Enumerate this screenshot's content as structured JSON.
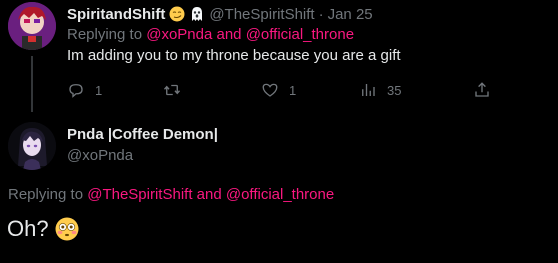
{
  "reply_tweet": {
    "author_name": "SpiritandShift",
    "author_handle": "@TheSpiritShift",
    "separator": "·",
    "date": "Jan 25",
    "badge_icons": [
      "smirk-emoji-icon",
      "ghost-emoji-icon"
    ],
    "replying_prefix": "Replying to",
    "replying_mention_1": "@xoPnda",
    "replying_and": "and",
    "replying_mention_2": "@official_throne",
    "text": "Im adding you to my throne because you are a gift",
    "stats": {
      "replies": "1",
      "retweets": "",
      "likes": "1",
      "views": "35"
    }
  },
  "main_tweet": {
    "author_name": "Pnda |Coffee Demon|",
    "author_handle": "@xoPnda",
    "replying_prefix": "Replying to",
    "replying_mention_1": "@TheSpiritShift",
    "replying_and": "and",
    "replying_mention_2": "@official_throne",
    "text": "Oh?",
    "text_emoji": "flushed-face-emoji-icon"
  },
  "colors": {
    "background": "#000000",
    "primary_text": "#e7e9ea",
    "secondary_text": "#71767b",
    "mention": "#f91880",
    "thread_line": "#333639"
  }
}
